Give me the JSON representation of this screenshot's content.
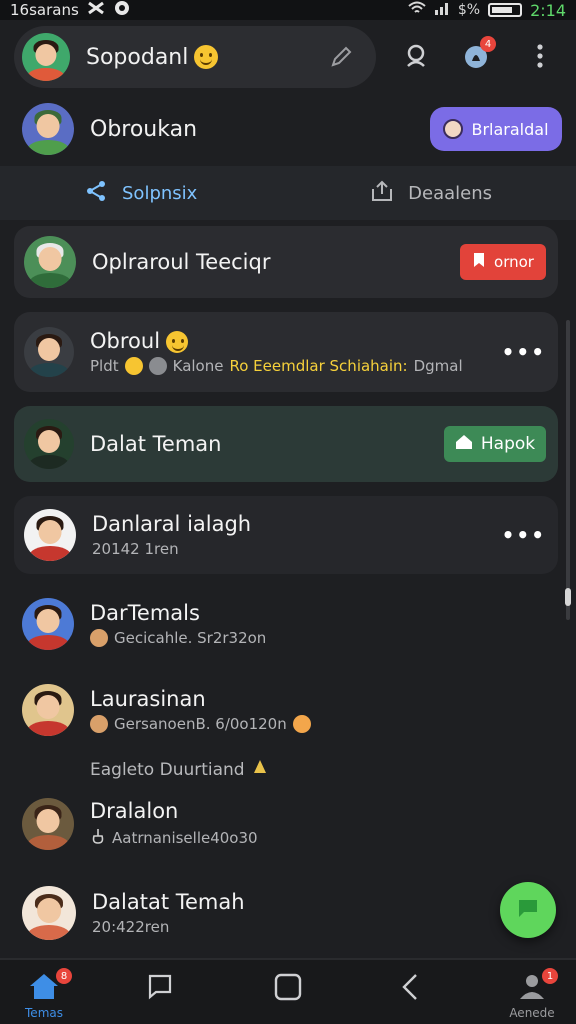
{
  "status": {
    "carrier": "16sarans",
    "battery": "$%",
    "time": "2:14"
  },
  "top_bar": {
    "name": "Sopodanl",
    "notif_count": "4"
  },
  "profile": {
    "name": "Obroukan",
    "button_label": "Brlaraldal"
  },
  "tabs": {
    "active": "Solpnsix",
    "inactive": "Deaalens"
  },
  "items": [
    {
      "title": "Oplraroul Teeciqr",
      "action": "ornor"
    },
    {
      "title": "Obroul",
      "sub_a": "Pldt",
      "sub_b": "Kalone",
      "sub_highlight": "Ro Eeemdlar Schiahain:",
      "sub_c": "Dgmal"
    },
    {
      "title": "Dalat Teman",
      "action": "Hapok"
    },
    {
      "title": "Danlaral ialagh",
      "sub": "20142 1ren"
    },
    {
      "title": "DarTemals",
      "sub": "Gecicahle. Sr2r32on"
    },
    {
      "title": "Laurasinan",
      "sub": "GersanoenB. 6/0o120n"
    },
    {
      "title": "Dralalon",
      "sub": "Aatrnaniselle40o30"
    },
    {
      "title": "Dalatat Temah",
      "sub": "20:422ren"
    }
  ],
  "section_label": "Eagleto Duurtiand",
  "nav": {
    "home_label": "Temas",
    "home_badge": "8",
    "profile_label": "Aenede",
    "profile_badge": "1"
  },
  "colors": {
    "accent_blue": "#7fc3ff",
    "purple_button": "#7b6ce6",
    "red_button": "#e2433a",
    "green_button": "#3d8a56",
    "fab": "#5fd65c"
  }
}
